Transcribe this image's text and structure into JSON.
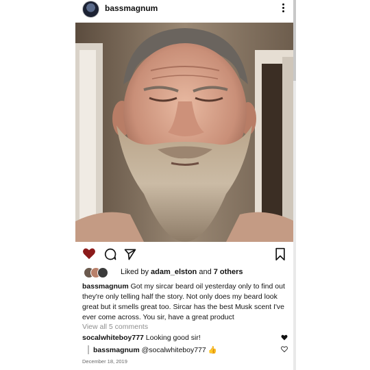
{
  "post": {
    "username": "bassmagnum",
    "liked_prefix": "Liked by ",
    "liked_user": "adam_elston",
    "liked_suffix_and": " and ",
    "liked_others": "7 others",
    "caption_user": "bassmagnum",
    "caption_text": "Got my sircar beard oil yesterday only to find out they're only telling half the story. Not only does my beard look great but it smells great too. Sircar has the best Musk scent I've ever come across. You sir, have a great product",
    "view_all": "View all 5 comments",
    "comment_user": "socalwhiteboy777",
    "comment_text": "Looking good sir!",
    "reply_user": "bassmagnum",
    "reply_text": "@socalwhiteboy777",
    "reply_emoji": "👍",
    "date": "December 18, 2019"
  },
  "icons": {
    "like": "heart-icon",
    "comment": "comment-icon",
    "share": "send-icon",
    "save": "bookmark-icon",
    "more": "more-vertical-icon"
  },
  "colors": {
    "liked_heart": "#8b1a1a",
    "text": "#111111",
    "muted": "#8e8e8e"
  }
}
